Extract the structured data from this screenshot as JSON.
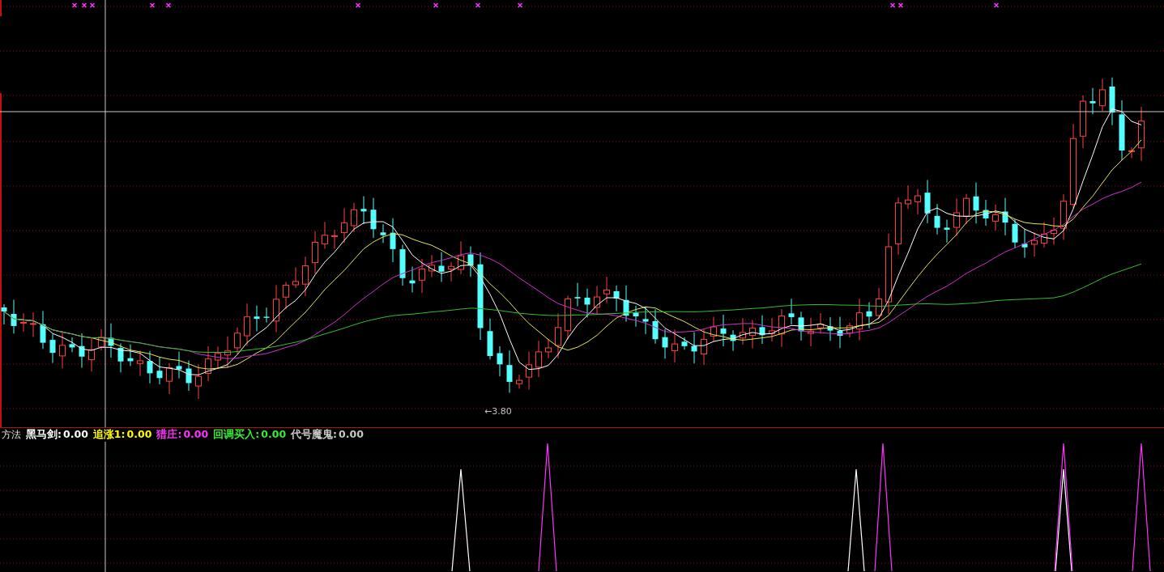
{
  "price_chart": {
    "low_label": "←3.80"
  },
  "indicator": {
    "title": "方法",
    "items": [
      {
        "label": "黑马剑:",
        "value": "0.00",
        "color": "#ffffff"
      },
      {
        "label": "追涨1:",
        "value": "0.00",
        "color": "#ffff00"
      },
      {
        "label": "猎庄:",
        "value": "0.00",
        "color": "#ff33ff"
      },
      {
        "label": "回调买入:",
        "value": "0.00",
        "color": "#33ee33"
      },
      {
        "label": "代号魔鬼:",
        "value": "0.00",
        "color": "#c8c8c8"
      }
    ]
  }
}
